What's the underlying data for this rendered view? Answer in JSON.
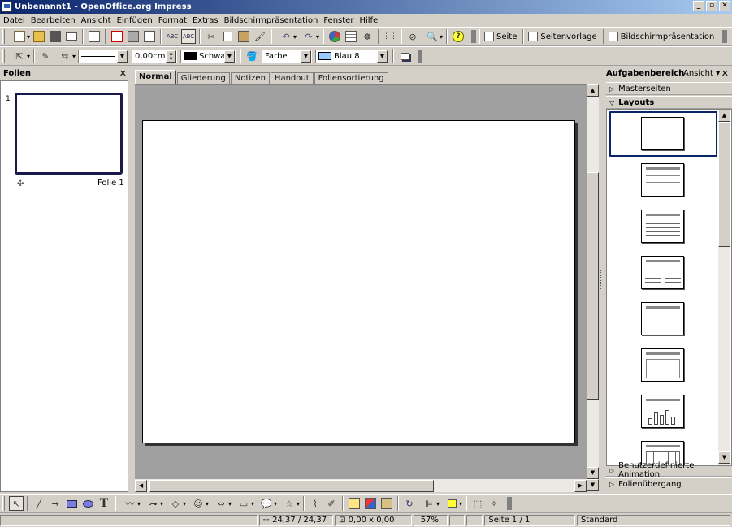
{
  "window": {
    "title": "Unbenannt1 - OpenOffice.org Impress",
    "minimize": "_",
    "restore": "▫",
    "close": "✕"
  },
  "menu": [
    "Datei",
    "Bearbeiten",
    "Ansicht",
    "Einfügen",
    "Format",
    "Extras",
    "Bildschirmpräsentation",
    "Fenster",
    "Hilfe"
  ],
  "toolbar1": {
    "seite_label": "Seite",
    "seitenvorlage_label": "Seitenvorlage",
    "bildschirm_label": "Bildschirmpräsentation"
  },
  "toolbar2": {
    "line_width": "0,00cm",
    "line_color": "Schwar",
    "area_style": "Farbe",
    "area_color": "Blau 8",
    "line_color_hex": "#000000",
    "area_color_hex": "#99ccff"
  },
  "slides_panel": {
    "title": "Folien",
    "close": "✕",
    "slides": [
      {
        "number": "1",
        "name": "Folie 1"
      }
    ]
  },
  "view_tabs": [
    "Normal",
    "Gliederung",
    "Notizen",
    "Handout",
    "Foliensortierung"
  ],
  "task_pane": {
    "title": "Aufgabenbereich",
    "view_menu": "Ansicht",
    "close": "✕",
    "sections": {
      "masterseiten": "Masterseiten",
      "layouts": "Layouts",
      "animation": "Benutzerdefinierte Animation",
      "uebergang": "Folienübergang"
    }
  },
  "status": {
    "position": "24,37 / 24,37",
    "size": "0,00 x 0,00",
    "zoom": "57%",
    "page": "Seite 1 / 1",
    "style": "Standard"
  }
}
